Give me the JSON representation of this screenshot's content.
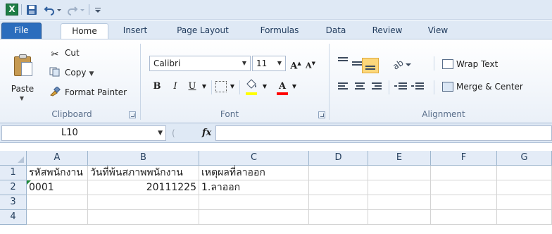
{
  "app": {
    "logo_letter": "X"
  },
  "tabs": {
    "file": "File",
    "home": "Home",
    "insert": "Insert",
    "page_layout": "Page Layout",
    "formulas": "Formulas",
    "data": "Data",
    "review": "Review",
    "view": "View"
  },
  "clipboard": {
    "paste": "Paste",
    "cut": "Cut",
    "copy": "Copy",
    "format_painter": "Format Painter",
    "group_label": "Clipboard"
  },
  "font": {
    "name": "Calibri",
    "size": "11",
    "group_label": "Font",
    "fill_color": "#ffff00",
    "font_color": "#ff0000"
  },
  "alignment": {
    "wrap_text": "Wrap Text",
    "merge_center": "Merge & Center",
    "group_label": "Alignment",
    "active": "bottom-align"
  },
  "formula_bar": {
    "name_box": "L10",
    "fx": "fx",
    "formula": ""
  },
  "sheet": {
    "columns": [
      "A",
      "B",
      "C",
      "D",
      "E",
      "F",
      "G"
    ],
    "rows": [
      "1",
      "2",
      "3",
      "4"
    ],
    "cells": {
      "A1": "รหัสพนักงาน",
      "B1": "วันที่พ้นสภาพพนักงาน",
      "C1": "เหตุผลที่ลาออก",
      "A2": "0001",
      "B2": "20111225",
      "C2": "1.ลาออก"
    }
  }
}
